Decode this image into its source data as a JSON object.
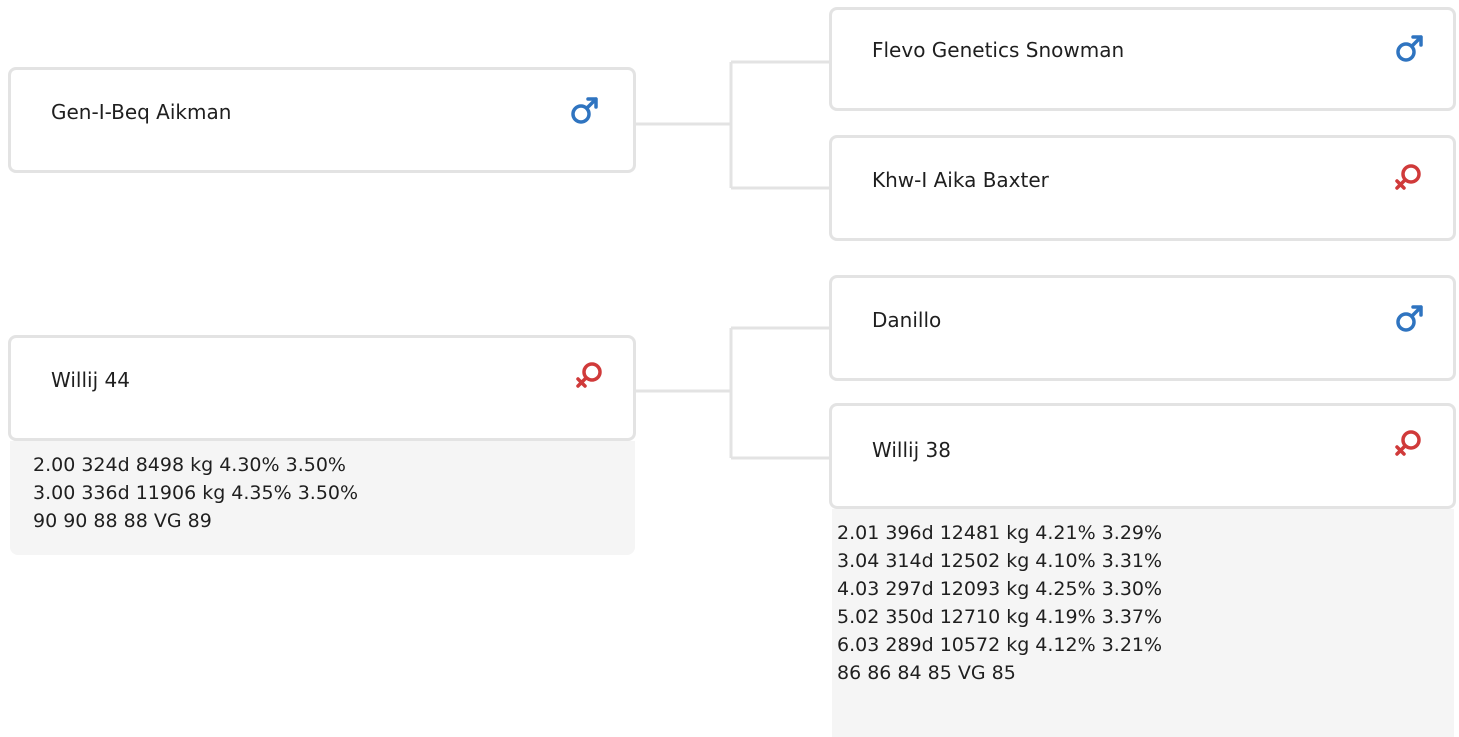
{
  "colors": {
    "male": "#2f74c0",
    "female": "#d03a3a",
    "border": "#e3e3e3",
    "connector": "#e3e3e3",
    "perf_bg": "#f5f5f5"
  },
  "sire": {
    "name": "Gen-I-Beq Aikman",
    "sex_icon": "male-icon",
    "sire": {
      "name": "Flevo Genetics Snowman",
      "sex_icon": "male-icon"
    },
    "dam": {
      "name": "Khw-I Aika Baxter",
      "sex_icon": "female-icon"
    }
  },
  "dam": {
    "name": "Willij 44",
    "sex_icon": "female-icon",
    "performance": [
      "2.00 324d 8498 kg 4.30% 3.50%",
      "3.00 336d 11906 kg 4.35% 3.50%",
      "90 90 88 88 VG 89"
    ],
    "sire": {
      "name": "Danillo",
      "sex_icon": "male-icon"
    },
    "dam": {
      "name": "Willij 38",
      "sex_icon": "female-icon",
      "performance": [
        "2.01 396d 12481 kg 4.21% 3.29%",
        "3.04 314d 12502 kg 4.10% 3.31%",
        "4.03 297d 12093 kg 4.25% 3.30%",
        "5.02 350d 12710 kg 4.19% 3.37%",
        "6.03 289d 10572 kg 4.12% 3.21%",
        "86 86 84 85 VG 85"
      ]
    }
  }
}
